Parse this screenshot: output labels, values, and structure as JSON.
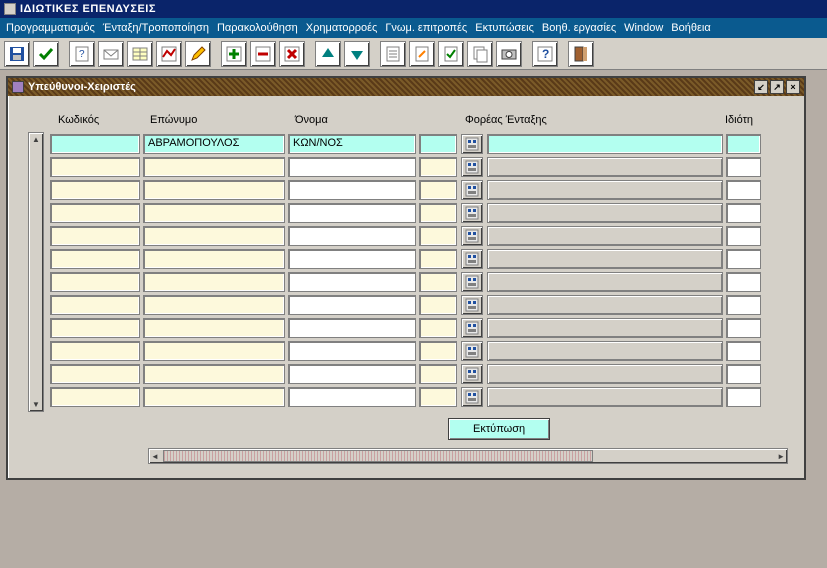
{
  "app": {
    "title": "ΙΔΙΩΤΙΚΕΣ ΕΠΕΝΔΥΣΕΙΣ"
  },
  "menu": {
    "items": [
      "Προγραμματισμός",
      "Ένταξη/Τροποποίηση",
      "Παρακολούθηση",
      "Χρηματορροές",
      "Γνωμ. επιτροπές",
      "Εκτυπώσεις",
      "Βοηθ. εργασίες",
      "Window",
      "Βοήθεια"
    ]
  },
  "toolbar_icons": [
    "save",
    "ok",
    "help-doc",
    "mail",
    "table",
    "chart",
    "pencil",
    "plus",
    "minus",
    "x",
    "arrow-up",
    "arrow-down",
    "doc-lines",
    "doc-edit",
    "doc-check",
    "doc-copy",
    "snap",
    "question",
    "exit"
  ],
  "window": {
    "title": "Υπεύθυνοι-Χειριστές",
    "buttons": [
      "min",
      "max",
      "close"
    ]
  },
  "columns": {
    "code": "Κωδικός",
    "surname": "Επώνυμο",
    "name": "Όνομα",
    "foreias": "Φορέας Ένταξης",
    "idioti": "Ιδιότη"
  },
  "rows": [
    {
      "code": "",
      "surname": "ΑΒΡΑΜΟΠΟΥΛΟΣ",
      "name": "ΚΩΝ/ΝΟΣ",
      "x1": "",
      "foreias": "",
      "idioti": "",
      "active": true
    },
    {
      "code": "",
      "surname": "",
      "name": "",
      "x1": "",
      "foreias": "",
      "idioti": ""
    },
    {
      "code": "",
      "surname": "",
      "name": "",
      "x1": "",
      "foreias": "",
      "idioti": ""
    },
    {
      "code": "",
      "surname": "",
      "name": "",
      "x1": "",
      "foreias": "",
      "idioti": ""
    },
    {
      "code": "",
      "surname": "",
      "name": "",
      "x1": "",
      "foreias": "",
      "idioti": ""
    },
    {
      "code": "",
      "surname": "",
      "name": "",
      "x1": "",
      "foreias": "",
      "idioti": ""
    },
    {
      "code": "",
      "surname": "",
      "name": "",
      "x1": "",
      "foreias": "",
      "idioti": ""
    },
    {
      "code": "",
      "surname": "",
      "name": "",
      "x1": "",
      "foreias": "",
      "idioti": ""
    },
    {
      "code": "",
      "surname": "",
      "name": "",
      "x1": "",
      "foreias": "",
      "idioti": ""
    },
    {
      "code": "",
      "surname": "",
      "name": "",
      "x1": "",
      "foreias": "",
      "idioti": ""
    },
    {
      "code": "",
      "surname": "",
      "name": "",
      "x1": "",
      "foreias": "",
      "idioti": ""
    },
    {
      "code": "",
      "surname": "",
      "name": "",
      "x1": "",
      "foreias": "",
      "idioti": ""
    }
  ],
  "buttons": {
    "print": "Εκτύπωση"
  }
}
